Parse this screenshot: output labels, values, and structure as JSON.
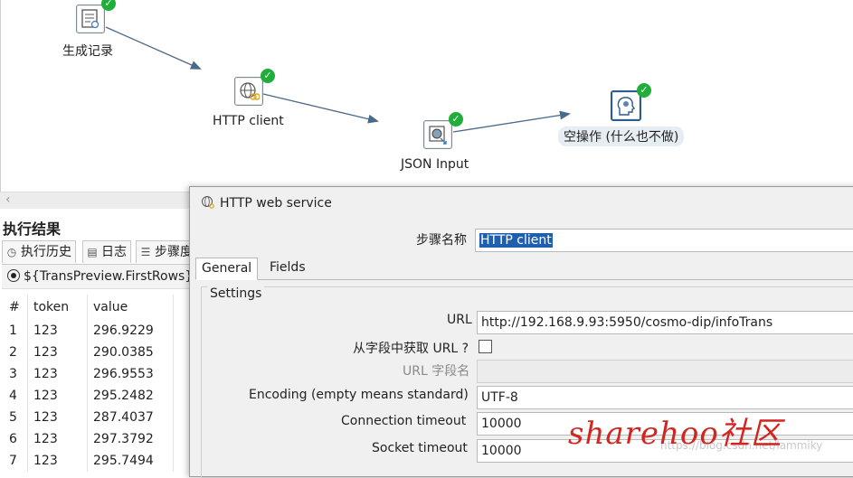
{
  "canvas": {
    "steps": [
      {
        "id": "generate",
        "label": "生成记录",
        "icon": "generate-rows-icon",
        "status": "success"
      },
      {
        "id": "http",
        "label": "HTTP client",
        "icon": "http-client-icon",
        "status": "success"
      },
      {
        "id": "json",
        "label": "JSON Input",
        "icon": "json-input-icon",
        "status": "success"
      },
      {
        "id": "dummy",
        "label": "空操作 (什么也不做)",
        "icon": "dummy-step-icon",
        "status": "success"
      }
    ]
  },
  "results": {
    "title": "执行结果",
    "tabs": [
      "执行历史",
      "日志",
      "步骤度"
    ],
    "preview_label": "${TransPreview.FirstRows}",
    "columns": [
      "#",
      "token",
      "value"
    ],
    "rows": [
      [
        "1",
        "123",
        "296.9229"
      ],
      [
        "2",
        "123",
        "290.0385"
      ],
      [
        "3",
        "123",
        "296.9553"
      ],
      [
        "4",
        "123",
        "295.2482"
      ],
      [
        "5",
        "123",
        "287.4037"
      ],
      [
        "6",
        "123",
        "297.3792"
      ],
      [
        "7",
        "123",
        "295.7494"
      ]
    ]
  },
  "dialog": {
    "title": "HTTP web service",
    "step_name_label": "步骤名称",
    "step_name_value": "HTTP client",
    "tabs": [
      "General",
      "Fields"
    ],
    "settings_label": "Settings",
    "url_label": "URL",
    "url_value": "http://192.168.9.93:5950/cosmo-dip/infoTrans",
    "url_from_field_label": "从字段中获取 URL ?",
    "url_field_name_label": "URL 字段名",
    "encoding_label": "Encoding (empty means standard)",
    "encoding_value": "UTF-8",
    "connection_timeout_label": "Connection timeout",
    "connection_timeout_value": "10000",
    "socket_timeout_label": "Socket timeout",
    "socket_timeout_value": "10000"
  },
  "watermark": {
    "text": "sharehoo社区",
    "url": "https://blog.csdn.net/lammiky",
    "color": "#d4241f"
  },
  "colors": {
    "success": "#1fae3a",
    "selection": "#1f5fb0",
    "hop": "#4a6a8a"
  }
}
